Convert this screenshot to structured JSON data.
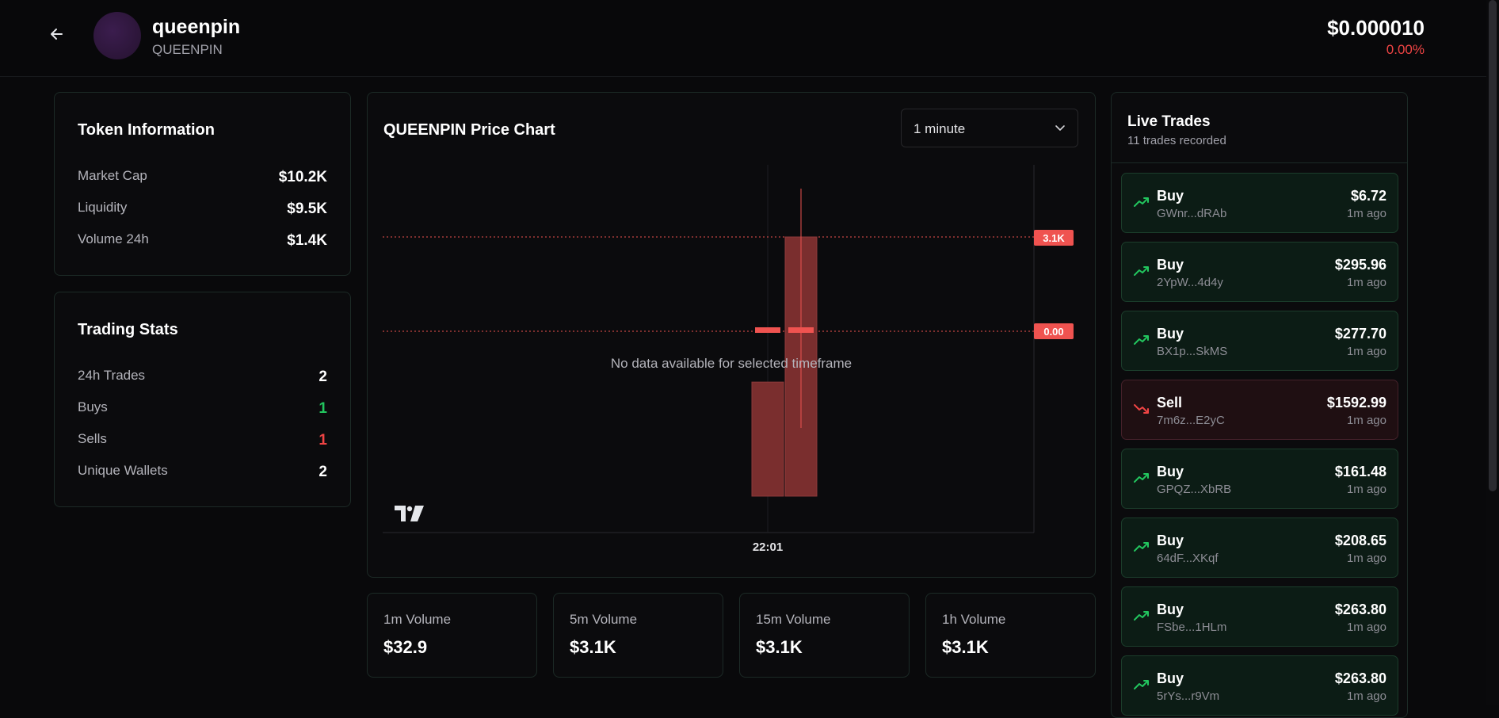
{
  "header": {
    "token_name": "queenpin",
    "token_symbol": "QUEENPIN",
    "price": "$0.000010",
    "change": "0.00%"
  },
  "token_info": {
    "title": "Token Information",
    "rows": [
      {
        "label": "Market Cap",
        "value": "$10.2K"
      },
      {
        "label": "Liquidity",
        "value": "$9.5K"
      },
      {
        "label": "Volume 24h",
        "value": "$1.4K"
      }
    ]
  },
  "trading_stats": {
    "title": "Trading Stats",
    "rows": [
      {
        "label": "24h Trades",
        "value": "2",
        "color": "#ffffff"
      },
      {
        "label": "Buys",
        "value": "1",
        "color": "#22c55e"
      },
      {
        "label": "Sells",
        "value": "1",
        "color": "#ef4444"
      },
      {
        "label": "Unique Wallets",
        "value": "2",
        "color": "#ffffff"
      }
    ]
  },
  "chart_panel": {
    "title": "QUEENPIN Price Chart",
    "timeframe": "1 minute",
    "empty_message": "No data available for selected timeframe",
    "x_tick": "22:01",
    "price_tags": [
      "3.1K",
      "0.00"
    ]
  },
  "chart_data": {
    "type": "bar",
    "categories": [
      "22:01"
    ],
    "values": [
      3100
    ],
    "ylim": [
      0,
      3100
    ]
  },
  "volumes": [
    {
      "label": "1m Volume",
      "value": "$32.9"
    },
    {
      "label": "5m Volume",
      "value": "$3.1K"
    },
    {
      "label": "15m Volume",
      "value": "$3.1K"
    },
    {
      "label": "1h Volume",
      "value": "$3.1K"
    }
  ],
  "live_trades": {
    "title": "Live Trades",
    "subtitle": "11 trades recorded",
    "items": [
      {
        "type": "Buy",
        "addr": "GWnr...dRAb",
        "amount": "$6.72",
        "time": "1m ago"
      },
      {
        "type": "Buy",
        "addr": "2YpW...4d4y",
        "amount": "$295.96",
        "time": "1m ago"
      },
      {
        "type": "Buy",
        "addr": "BX1p...SkMS",
        "amount": "$277.70",
        "time": "1m ago"
      },
      {
        "type": "Sell",
        "addr": "7m6z...E2yC",
        "amount": "$1592.99",
        "time": "1m ago"
      },
      {
        "type": "Buy",
        "addr": "GPQZ...XbRB",
        "amount": "$161.48",
        "time": "1m ago"
      },
      {
        "type": "Buy",
        "addr": "64dF...XKqf",
        "amount": "$208.65",
        "time": "1m ago"
      },
      {
        "type": "Buy",
        "addr": "FSbe...1HLm",
        "amount": "$263.80",
        "time": "1m ago"
      },
      {
        "type": "Buy",
        "addr": "5rYs...r9Vm",
        "amount": "$263.80",
        "time": "1m ago"
      }
    ]
  },
  "colors": {
    "buy": "#22c55e",
    "sell": "#ef4444",
    "accent_red": "#ef5350"
  }
}
